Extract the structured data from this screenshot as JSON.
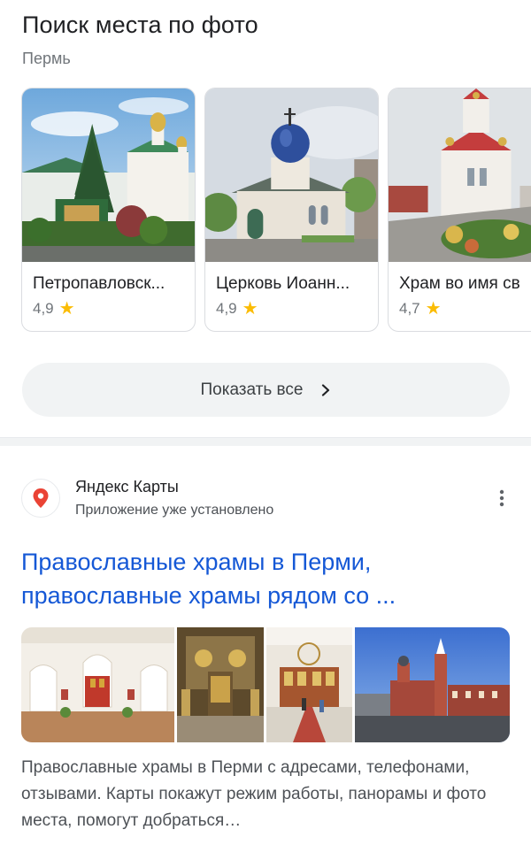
{
  "header": {
    "title": "Поиск места по фото",
    "subtitle": "Пермь"
  },
  "places": [
    {
      "name": "Петропавловск...",
      "rating": "4,9"
    },
    {
      "name": "Церковь Иоанн...",
      "rating": "4,9"
    },
    {
      "name": "Храм во имя св",
      "rating": "4,7"
    }
  ],
  "show_all": {
    "label": "Показать все"
  },
  "result": {
    "source_name": "Яндекс Карты",
    "source_status": "Приложение уже установлено",
    "title": "Православные храмы в Перми, православные храмы рядом со ...",
    "snippet": "Православные храмы в Перми с адресами, телефонами, отзывами. Карты покажут режим работы, панорамы и фото места, помогут добраться…"
  },
  "colors": {
    "link": "#1558d6",
    "star": "#fbbc04",
    "pin": "#ea4335"
  },
  "icons": {
    "star": "star-icon",
    "chevron": "chevron-right-icon",
    "source": "map-pin-icon",
    "more": "more-vert-icon"
  }
}
